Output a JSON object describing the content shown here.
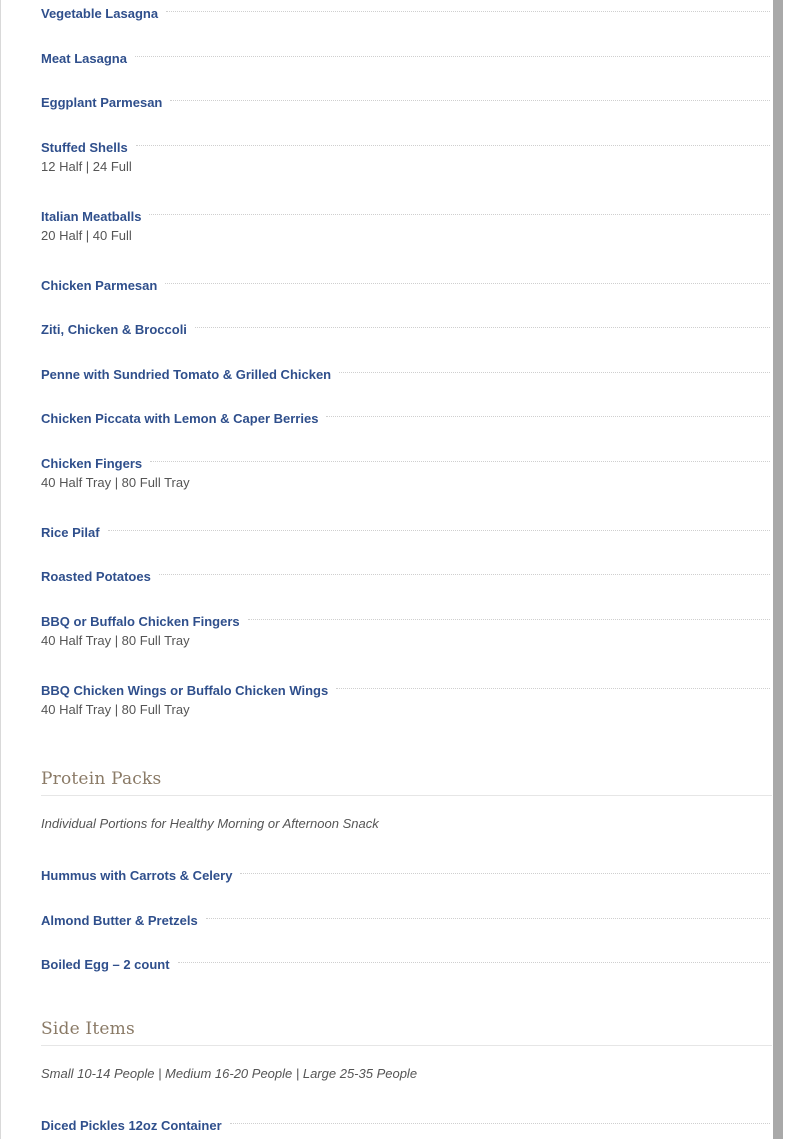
{
  "entrees": [
    {
      "name": "Vegetable Lasagna",
      "desc": ""
    },
    {
      "name": "Meat Lasagna",
      "desc": ""
    },
    {
      "name": "Eggplant Parmesan",
      "desc": ""
    },
    {
      "name": "Stuffed Shells",
      "desc": "12 Half | 24 Full"
    },
    {
      "name": "Italian Meatballs",
      "desc": "20 Half | 40 Full"
    },
    {
      "name": "Chicken Parmesan",
      "desc": ""
    },
    {
      "name": "Ziti, Chicken & Broccoli",
      "desc": ""
    },
    {
      "name": "Penne with Sundried Tomato & Grilled Chicken",
      "desc": ""
    },
    {
      "name": "Chicken Piccata with Lemon & Caper Berries",
      "desc": ""
    },
    {
      "name": "Chicken Fingers",
      "desc": "40 Half Tray | 80 Full Tray"
    },
    {
      "name": "Rice Pilaf",
      "desc": ""
    },
    {
      "name": "Roasted Potatoes",
      "desc": ""
    },
    {
      "name": "BBQ or Buffalo Chicken Fingers",
      "desc": "40 Half Tray | 80 Full Tray"
    },
    {
      "name": "BBQ Chicken Wings or Buffalo Chicken Wings",
      "desc": "40 Half Tray | 80 Full Tray"
    }
  ],
  "protein_packs": {
    "title": "Protein Packs",
    "note": "Individual Portions for Healthy Morning or Afternoon Snack",
    "items": [
      {
        "name": "Hummus with Carrots & Celery"
      },
      {
        "name": "Almond Butter & Pretzels"
      },
      {
        "name": "Boiled Egg – 2 count"
      }
    ]
  },
  "side_items": {
    "title": "Side Items",
    "note": "Small 10-14 People | Medium 16-20 People | Large 25-35 People",
    "items": [
      {
        "name": "Diced Pickles 12oz Container"
      }
    ]
  }
}
